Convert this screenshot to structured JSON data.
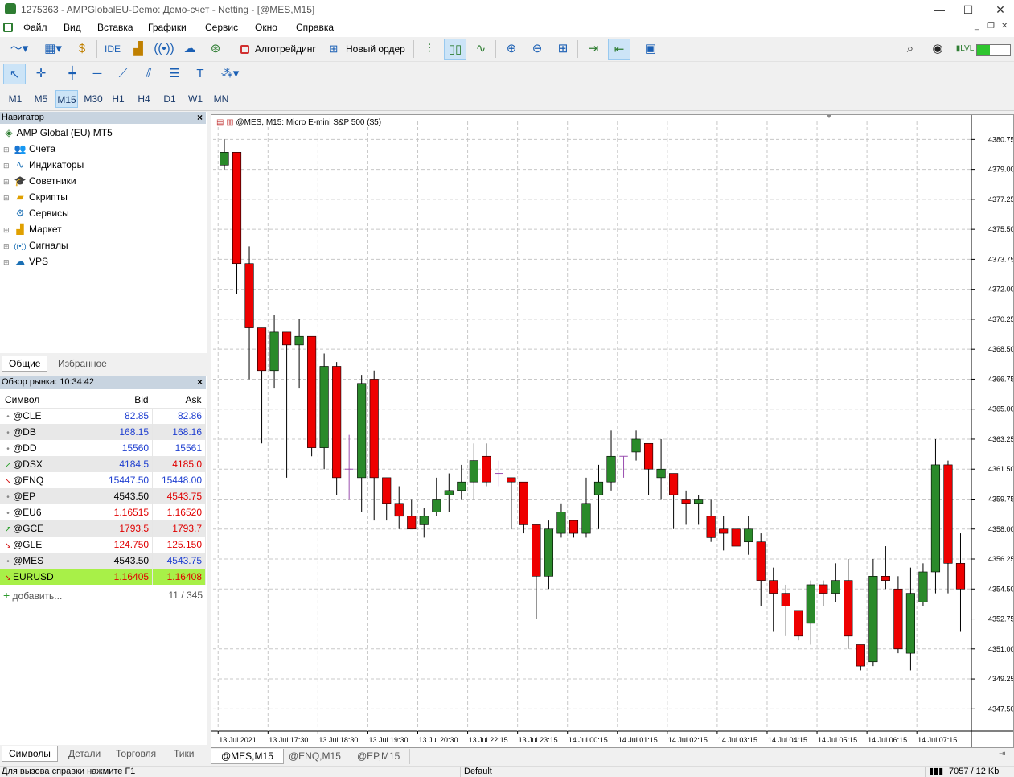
{
  "window": {
    "title": "1275363 - AMPGlobalEU-Demo: Демо-счет - Netting - [@MES,M15]",
    "minimize": "—",
    "maximize": "☐",
    "close": "✕"
  },
  "menu": {
    "items": [
      "Файл",
      "Вид",
      "Вставка",
      "Графики",
      "Сервис",
      "Окно",
      "Справка"
    ],
    "mdi_controls": [
      "_",
      "❐",
      "✕"
    ]
  },
  "toolbar": {
    "ide": "IDE",
    "algotrading": "Алготрейдинг",
    "new_order": "Новый ордер"
  },
  "timeframes": [
    "M1",
    "M5",
    "M15",
    "M30",
    "H1",
    "H4",
    "D1",
    "W1",
    "MN"
  ],
  "active_timeframe": "M15",
  "navigator": {
    "title": "Навигатор",
    "root": "AMP Global (EU) MT5",
    "items": [
      {
        "label": "Счета",
        "icon": "accounts-icon"
      },
      {
        "label": "Индикаторы",
        "icon": "indicators-icon"
      },
      {
        "label": "Советники",
        "icon": "experts-icon"
      },
      {
        "label": "Скрипты",
        "icon": "scripts-icon"
      },
      {
        "label": "Сервисы",
        "icon": "services-icon"
      },
      {
        "label": "Маркет",
        "icon": "market-icon"
      },
      {
        "label": "Сигналы",
        "icon": "signals-icon"
      },
      {
        "label": "VPS",
        "icon": "vps-icon"
      }
    ],
    "tabs": [
      "Общие",
      "Избранное"
    ]
  },
  "market_watch": {
    "title": "Обзор рынка: 10:34:42",
    "headers": [
      "Символ",
      "Bid",
      "Ask"
    ],
    "rows": [
      {
        "symbol": "@CLE",
        "bid": "82.85",
        "ask": "82.86",
        "dir": "none",
        "bid_color": "#1f3fd0",
        "ask_color": "#1f3fd0"
      },
      {
        "symbol": "@DB",
        "bid": "168.15",
        "ask": "168.16",
        "dir": "none",
        "bid_color": "#1f3fd0",
        "ask_color": "#1f3fd0"
      },
      {
        "symbol": "@DD",
        "bid": "15560",
        "ask": "15561",
        "dir": "none",
        "bid_color": "#1f3fd0",
        "ask_color": "#1f3fd0"
      },
      {
        "symbol": "@DSX",
        "bid": "4184.5",
        "ask": "4185.0",
        "dir": "up",
        "bid_color": "#1f3fd0",
        "ask_color": "#e00000"
      },
      {
        "symbol": "@ENQ",
        "bid": "15447.50",
        "ask": "15448.00",
        "dir": "down",
        "bid_color": "#1f3fd0",
        "ask_color": "#1f3fd0"
      },
      {
        "symbol": "@EP",
        "bid": "4543.50",
        "ask": "4543.75",
        "dir": "none",
        "bid_color": "#000000",
        "ask_color": "#e00000"
      },
      {
        "symbol": "@EU6",
        "bid": "1.16515",
        "ask": "1.16520",
        "dir": "none",
        "bid_color": "#e00000",
        "ask_color": "#e00000"
      },
      {
        "symbol": "@GCE",
        "bid": "1793.5",
        "ask": "1793.7",
        "dir": "up",
        "bid_color": "#e00000",
        "ask_color": "#e00000"
      },
      {
        "symbol": "@GLE",
        "bid": "124.750",
        "ask": "125.150",
        "dir": "down",
        "bid_color": "#e00000",
        "ask_color": "#e00000"
      },
      {
        "symbol": "@MES",
        "bid": "4543.50",
        "ask": "4543.75",
        "dir": "none",
        "bid_color": "#000000",
        "ask_color": "#1f3fd0"
      },
      {
        "symbol": "EURUSD",
        "bid": "1.16405",
        "ask": "1.16408",
        "dir": "down",
        "bid_color": "#e00000",
        "ask_color": "#e00000"
      }
    ],
    "add_label": "добавить...",
    "count": "11 / 345",
    "tabs": [
      "Символы",
      "Детали",
      "Торговля",
      "Тики"
    ]
  },
  "chart": {
    "header": "@MES, M15:  Micro E-mini S&P 500 ($5)",
    "tabs": [
      "@MES,M15",
      "@ENQ,M15",
      "@EP,M15"
    ]
  },
  "chart_data": {
    "type": "candlestick",
    "title": "@MES, M15:  Micro E-mini S&P 500 ($5)",
    "ylim": [
      4346.2,
      4381.8
    ],
    "y_ticks": [
      "4380.75",
      "4379.00",
      "4377.25",
      "4375.50",
      "4373.75",
      "4372.00",
      "4370.25",
      "4368.50",
      "4366.75",
      "4365.00",
      "4363.25",
      "4361.50",
      "4359.75",
      "4358.00",
      "4356.25",
      "4354.50",
      "4352.75",
      "4351.00",
      "4349.25",
      "4347.50"
    ],
    "x_ticks": [
      "13 Jul 2021",
      "13 Jul 17:30",
      "13 Jul 18:30",
      "13 Jul 19:30",
      "13 Jul 20:30",
      "13 Jul 22:15",
      "13 Jul 23:15",
      "14 Jul 00:15",
      "14 Jul 01:15",
      "14 Jul 02:15",
      "14 Jul 03:15",
      "14 Jul 04:15",
      "14 Jul 05:15",
      "14 Jul 06:15",
      "14 Jul 07:15"
    ],
    "grid": true,
    "up_color": "#2a8a2a",
    "down_color": "#ee0000",
    "doji_color": "#9a4fb0",
    "candles": [
      [
        4379.25,
        4380.75,
        4379.0,
        4380.0
      ],
      [
        4380.0,
        4380.0,
        4371.75,
        4373.5
      ],
      [
        4373.5,
        4374.5,
        4366.75,
        4369.75
      ],
      [
        4369.75,
        4369.75,
        4363.0,
        4367.25
      ],
      [
        4367.25,
        4370.5,
        4366.25,
        4369.5
      ],
      [
        4369.5,
        4369.5,
        4361.0,
        4368.75
      ],
      [
        4368.75,
        4370.25,
        4366.25,
        4369.25
      ],
      [
        4369.25,
        4369.25,
        4362.25,
        4362.75
      ],
      [
        4362.75,
        4368.25,
        4361.5,
        4367.5
      ],
      [
        4367.5,
        4367.75,
        4360.0,
        4361.0
      ],
      [
        4361.5,
        4363.5,
        4359.75,
        4361.5
      ],
      [
        4361.0,
        4367.0,
        4359.0,
        4366.5
      ],
      [
        4366.75,
        4367.25,
        4358.5,
        4361.0
      ],
      [
        4361.0,
        4361.0,
        4358.5,
        4359.5
      ],
      [
        4359.5,
        4360.5,
        4358.0,
        4358.75
      ],
      [
        4358.75,
        4359.75,
        4358.0,
        4358.0
      ],
      [
        4358.25,
        4359.25,
        4357.5,
        4358.75
      ],
      [
        4359.0,
        4361.0,
        4358.75,
        4359.75
      ],
      [
        4360.0,
        4361.25,
        4359.0,
        4360.25
      ],
      [
        4360.25,
        4361.75,
        4359.75,
        4360.75
      ],
      [
        4360.75,
        4363.0,
        4359.75,
        4362.0
      ],
      [
        4362.25,
        4363.0,
        4360.5,
        4360.75
      ],
      [
        4361.25,
        4362.0,
        4360.5,
        4361.25
      ],
      [
        4361.0,
        4361.0,
        4358.0,
        4360.75
      ],
      [
        4360.75,
        4360.75,
        4357.75,
        4358.25
      ],
      [
        4358.25,
        4358.25,
        4352.75,
        4355.25
      ],
      [
        4355.25,
        4358.5,
        4354.5,
        4358.0
      ],
      [
        4357.75,
        4359.5,
        4357.5,
        4359.0
      ],
      [
        4358.5,
        4358.5,
        4357.5,
        4357.75
      ],
      [
        4357.75,
        4361.0,
        4357.5,
        4359.5
      ],
      [
        4360.0,
        4361.75,
        4358.0,
        4360.75
      ],
      [
        4360.75,
        4363.75,
        4360.25,
        4362.25
      ],
      [
        4362.25,
        4362.25,
        4361.0,
        4362.25
      ],
      [
        4362.5,
        4363.75,
        4362.0,
        4363.25
      ],
      [
        4363.0,
        4363.0,
        4360.0,
        4361.5
      ],
      [
        4361.0,
        4363.25,
        4359.75,
        4361.5
      ],
      [
        4361.25,
        4361.25,
        4358.0,
        4360.0
      ],
      [
        4359.75,
        4360.25,
        4358.25,
        4359.5
      ],
      [
        4359.5,
        4360.0,
        4358.25,
        4359.75
      ],
      [
        4358.75,
        4359.75,
        4357.25,
        4357.5
      ],
      [
        4358.0,
        4358.75,
        4356.75,
        4357.75
      ],
      [
        4358.0,
        4358.0,
        4357.25,
        4357.0
      ],
      [
        4357.25,
        4358.75,
        4356.5,
        4358.0
      ],
      [
        4357.25,
        4357.75,
        4353.5,
        4355.0
      ],
      [
        4355.0,
        4355.75,
        4352.0,
        4354.25
      ],
      [
        4354.25,
        4354.75,
        4351.75,
        4353.5
      ],
      [
        4353.25,
        4353.25,
        4351.5,
        4351.75
      ],
      [
        4352.5,
        4355.0,
        4351.25,
        4354.75
      ],
      [
        4354.75,
        4355.0,
        4353.5,
        4354.25
      ],
      [
        4354.25,
        4356.0,
        4353.75,
        4355.0
      ],
      [
        4355.0,
        4356.25,
        4351.0,
        4351.75
      ],
      [
        4351.25,
        4351.25,
        4349.75,
        4350.0
      ],
      [
        4350.25,
        4356.25,
        4350.0,
        4355.25
      ],
      [
        4355.25,
        4357.0,
        4354.5,
        4355.0
      ],
      [
        4354.5,
        4355.25,
        4350.75,
        4351.0
      ],
      [
        4350.75,
        4355.75,
        4349.75,
        4354.25
      ],
      [
        4353.75,
        4356.0,
        4353.5,
        4355.5
      ],
      [
        4355.5,
        4363.25,
        4354.25,
        4361.75
      ],
      [
        4361.75,
        4362.0,
        4354.25,
        4356.0
      ],
      [
        4356.0,
        4357.75,
        4352.0,
        4354.5
      ]
    ]
  },
  "status": {
    "help": "Для вызова справки нажмите F1",
    "profile": "Default",
    "traffic": "7057 / 12 Kb"
  }
}
